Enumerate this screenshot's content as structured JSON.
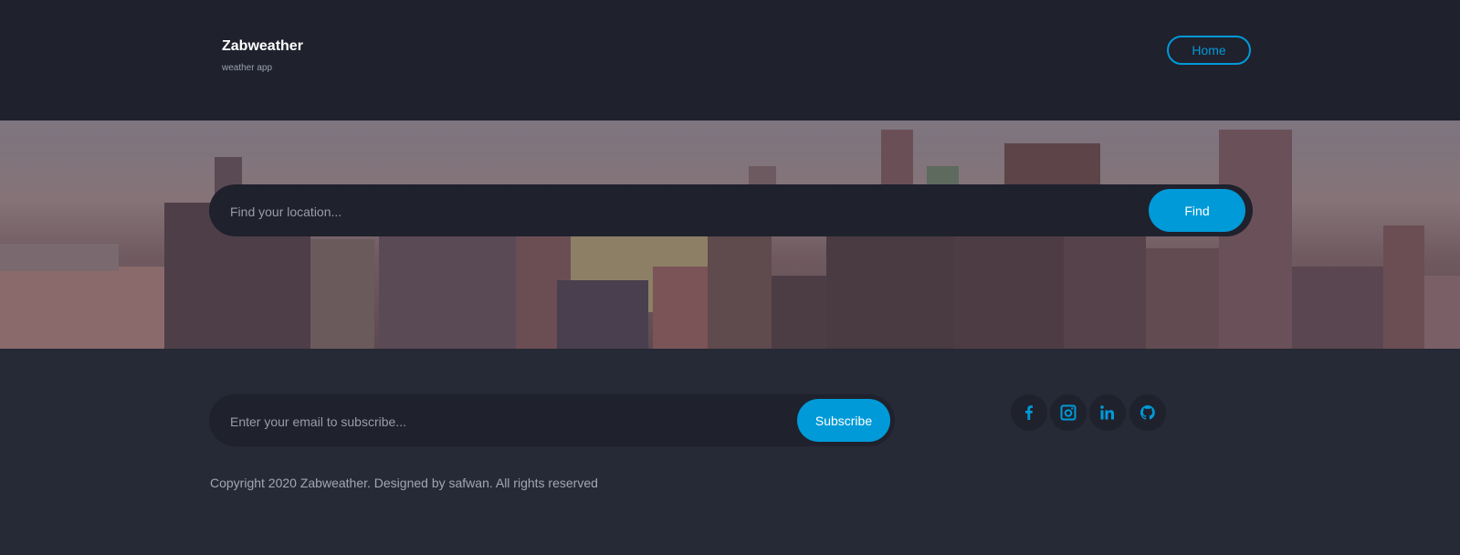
{
  "header": {
    "title": "Zabweather",
    "subtitle": "weather app",
    "nav_home": "Home"
  },
  "search": {
    "placeholder": "Find your location...",
    "button_label": "Find"
  },
  "footer": {
    "subscribe_placeholder": "Enter your email to subscribe...",
    "subscribe_button": "Subscribe",
    "copyright": "Copyright 2020 Zabweather. Designed by safwan. All rights reserved",
    "social_icons": [
      "facebook-icon",
      "instagram-icon",
      "linkedin-icon",
      "github-icon"
    ]
  },
  "colors": {
    "accent": "#009ad8",
    "header_bg": "#1f212d",
    "page_bg": "#262936"
  }
}
